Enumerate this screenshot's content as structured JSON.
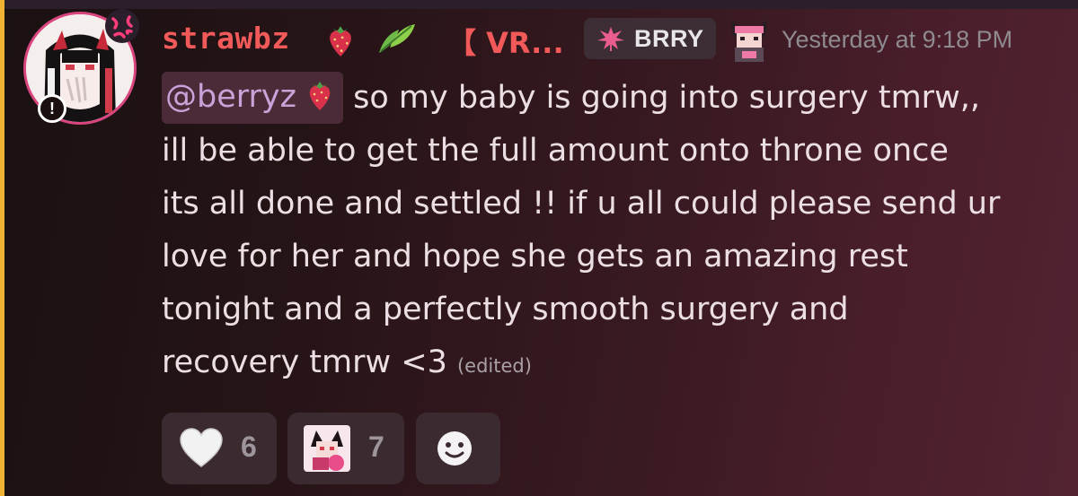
{
  "message": {
    "author": {
      "username": "strawbz",
      "clan_tag": "【 VR...",
      "role_tag": "BRRY",
      "timestamp": "Yesterday at 9:18 PM",
      "warning_badge": "!"
    },
    "mention": "@berryz",
    "lines": [
      "so my baby is going into surgery tmrw,,",
      "ill be able to get the full amount onto throne once",
      "its all done and settled !! if u all could please send ur",
      "love for her and hope she gets an amazing rest",
      "tonight and a perfectly smooth surgery and",
      "recovery tmrw <3"
    ],
    "edited_label": "(edited)",
    "reactions": [
      {
        "icon": "white-heart-icon",
        "count": "6"
      },
      {
        "icon": "custom-sticker-icon",
        "count": "7"
      }
    ],
    "add_reaction_icon": "smile-icon"
  },
  "colors": {
    "username": "#f25a5a",
    "mention_text": "#c9a2d8",
    "mention_bg": "#4a2b37",
    "accent_bar": "#f0b232",
    "timestamp": "#8f8a90"
  }
}
